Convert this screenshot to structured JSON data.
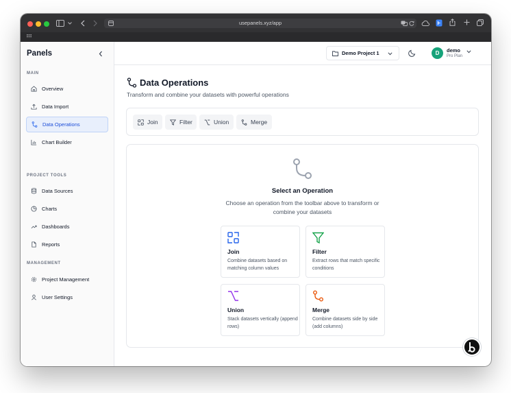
{
  "browser": {
    "url": "usepanels.xyz/app"
  },
  "sidebar": {
    "brand": "Panels",
    "sections": [
      {
        "title": "MAIN",
        "items": [
          {
            "label": "Overview",
            "icon": "home-icon"
          },
          {
            "label": "Data Import",
            "icon": "upload-icon"
          },
          {
            "label": "Data Operations",
            "icon": "git-merge-icon",
            "active": true
          },
          {
            "label": "Chart Builder",
            "icon": "bar-chart-icon"
          }
        ]
      },
      {
        "title": "PROJECT TOOLS",
        "items": [
          {
            "label": "Data Sources",
            "icon": "database-icon"
          },
          {
            "label": "Charts",
            "icon": "pie-chart-icon"
          },
          {
            "label": "Dashboards",
            "icon": "trend-icon"
          },
          {
            "label": "Reports",
            "icon": "file-icon"
          }
        ]
      },
      {
        "title": "MANAGEMENT",
        "items": [
          {
            "label": "Project Management",
            "icon": "gear-icon"
          },
          {
            "label": "User Settings",
            "icon": "user-icon"
          }
        ]
      }
    ]
  },
  "header": {
    "project": "Demo Project 1",
    "user": {
      "initial": "D",
      "name": "demo",
      "plan": "Pro Plan",
      "avatar_color": "#16a37a"
    }
  },
  "main": {
    "title": "Data Operations",
    "subtitle": "Transform and combine your datasets with powerful operations",
    "toolbar": [
      {
        "label": "Join",
        "icon": "join-icon"
      },
      {
        "label": "Filter",
        "icon": "filter-icon"
      },
      {
        "label": "Union",
        "icon": "union-icon"
      },
      {
        "label": "Merge",
        "icon": "merge-icon"
      }
    ],
    "empty_state": {
      "title": "Select an Operation",
      "description": "Choose an operation from the toolbar above to transform or combine your datasets"
    },
    "operations": [
      {
        "name": "Join",
        "description": "Combine datasets based on matching column values",
        "color": "#2563eb"
      },
      {
        "name": "Filter",
        "description": "Extract rows that match specific conditions",
        "color": "#16a34a"
      },
      {
        "name": "Union",
        "description": "Stack datasets vertically (append rows)",
        "color": "#9333ea"
      },
      {
        "name": "Merge",
        "description": "Combine datasets side by side (add columns)",
        "color": "#ea580c"
      }
    ]
  },
  "colors": {
    "active_bg": "#e8effc",
    "active_text": "#1d4ed8"
  }
}
